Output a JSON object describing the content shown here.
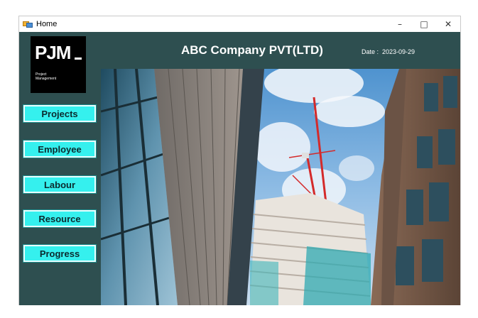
{
  "window": {
    "title": "Home",
    "minimize_glyph": "–",
    "maximize_glyph": "□",
    "close_glyph": "✕"
  },
  "logo": {
    "main": "PJM",
    "subtitle_line1": "Project",
    "subtitle_line2": "Management"
  },
  "header": {
    "company": "ABC Company PVT(LTD)",
    "date_label": "Date :",
    "date_value": "2023-09-29"
  },
  "nav": {
    "projects": "Projects",
    "employee": "Employee",
    "labour": "Labour",
    "resource": "Resource",
    "progress": "Progress"
  },
  "colors": {
    "panel": "#2e4f50",
    "button": "#35f0ee"
  }
}
